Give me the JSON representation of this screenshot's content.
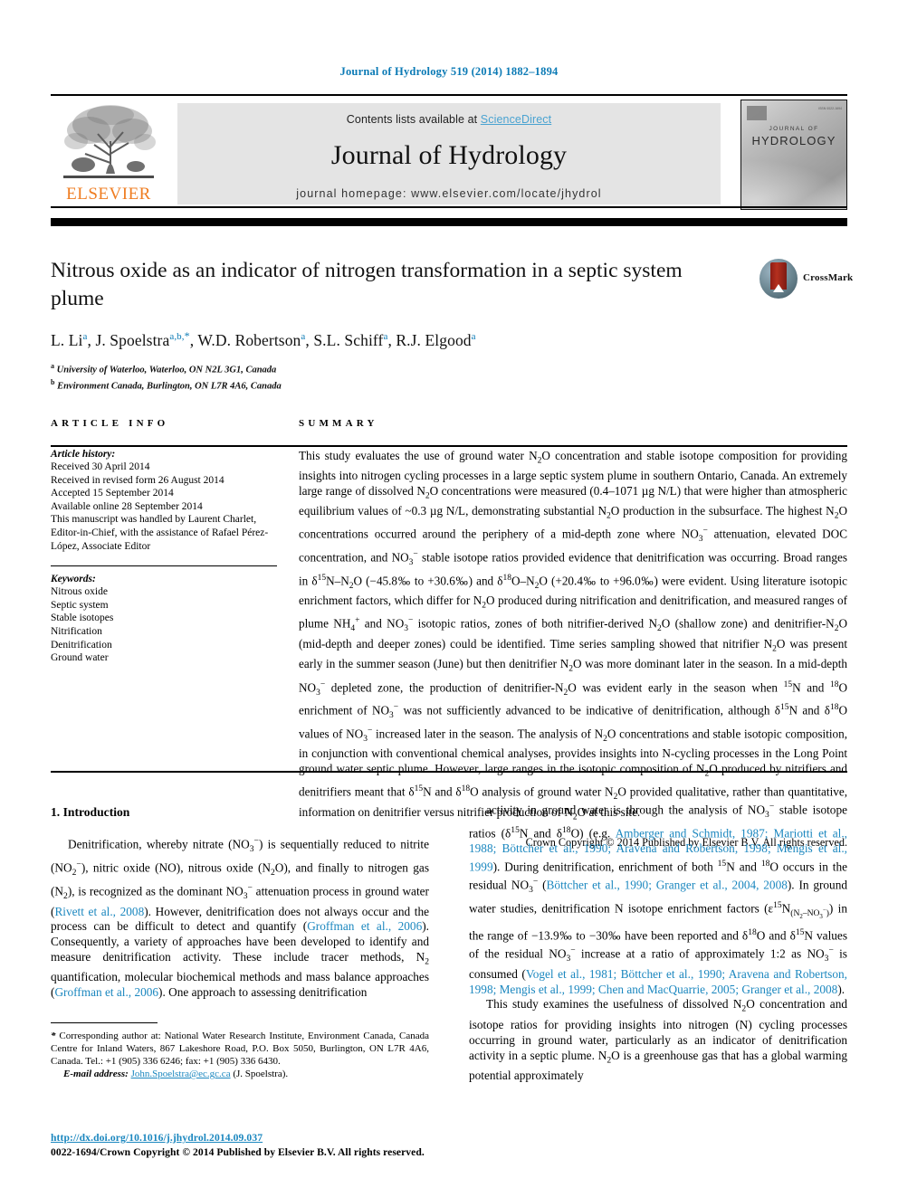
{
  "running_head": "Journal of Hydrology 519 (2014) 1882–1894",
  "masthead": {
    "contents_prefix": "Contents lists available at ",
    "sciencedirect": "ScienceDirect",
    "journal_title": "Journal of Hydrology",
    "homepage": "journal homepage: www.elsevier.com/locate/jhydrol",
    "publisher_wordmark": "ELSEVIER",
    "cover_top_line": "JOURNAL OF",
    "cover_bottom_line": "HYDROLOGY",
    "cover_isbn": "ISSN 0022-1694",
    "accent_link_color": "#4aa3d1",
    "publisher_color": "#ef7d22"
  },
  "article": {
    "title": "Nitrous oxide as an indicator of nitrogen transformation in a septic system plume",
    "crossmark_label": "CrossMark",
    "authors_plain": "L. Li a, J. Spoelstra a,b,*, W.D. Robertson a, S.L. Schiff a, R.J. Elgood a",
    "authors": [
      {
        "name": "L. Li",
        "marks": "a"
      },
      {
        "name": "J. Spoelstra",
        "marks": "a,b,*"
      },
      {
        "name": "W.D. Robertson",
        "marks": "a"
      },
      {
        "name": "S.L. Schiff",
        "marks": "a"
      },
      {
        "name": "R.J. Elgood",
        "marks": "a"
      }
    ],
    "affiliations": [
      {
        "mark": "a",
        "text": "University of Waterloo, Waterloo, ON N2L 3G1, Canada"
      },
      {
        "mark": "b",
        "text": "Environment Canada, Burlington, ON L7R 4A6, Canada"
      }
    ]
  },
  "article_info": {
    "heading": "ARTICLE INFO",
    "history_label": "Article history:",
    "history": [
      "Received 30 April 2014",
      "Received in revised form 26 August 2014",
      "Accepted 15 September 2014",
      "Available online 28 September 2014",
      "This manuscript was handled by Laurent Charlet, Editor-in-Chief, with the assistance of Rafael Pérez-López, Associate Editor"
    ],
    "keywords_label": "Keywords:",
    "keywords": [
      "Nitrous oxide",
      "Septic system",
      "Stable isotopes",
      "Nitrification",
      "Denitrification",
      "Ground water"
    ]
  },
  "summary": {
    "heading": "SUMMARY",
    "paragraph_html": "This study evaluates the use of ground water N<sub>2</sub>O concentration and stable isotope composition for providing insights into nitrogen cycling processes in a large septic system plume in southern Ontario, Canada. An extremely large range of dissolved N<sub>2</sub>O concentrations were measured (0.4–1071 µg N/L) that were higher than atmospheric equilibrium values of ~0.3 µg N/L, demonstrating substantial N<sub>2</sub>O production in the subsurface. The highest N<sub>2</sub>O concentrations occurred around the periphery of a mid-depth zone where NO<sub>3</sub><sup>−</sup> attenuation, elevated DOC concentration, and NO<sub>3</sub><sup>−</sup> stable isotope ratios provided evidence that denitrification was occurring. Broad ranges in δ<sup>15</sup>N–N<sub>2</sub>O (−45.8‰ to +30.6‰) and δ<sup>18</sup>O–N<sub>2</sub>O (+20.4‰ to +96.0‰) were evident. Using literature isotopic enrichment factors, which differ for N<sub>2</sub>O produced during nitrification and denitrification, and measured ranges of plume NH<sub>4</sub><sup>+</sup> and NO<sub>3</sub><sup>−</sup> isotopic ratios, zones of both nitrifier-derived N<sub>2</sub>O (shallow zone) and denitrifier-N<sub>2</sub>O (mid-depth and deeper zones) could be identified. Time series sampling showed that nitrifier N<sub>2</sub>O was present early in the summer season (June) but then denitrifier N<sub>2</sub>O was more dominant later in the season. In a mid-depth NO<sub>3</sub><sup>−</sup> depleted zone, the production of denitrifier-N<sub>2</sub>O was evident early in the season when <sup>15</sup>N and <sup>18</sup>O enrichment of NO<sub>3</sub><sup>−</sup> was not sufficiently advanced to be indicative of denitrification, although δ<sup>15</sup>N and δ<sup>18</sup>O values of NO<sub>3</sub><sup>−</sup> increased later in the season. The analysis of N<sub>2</sub>O concentrations and stable isotopic composition, in conjunction with conventional chemical analyses, provides insights into N-cycling processes in the Long Point ground water septic plume. However, large ranges in the isotopic composition of N<sub>2</sub>O produced by nitrifiers and denitrifiers meant that δ<sup>15</sup>N and δ<sup>18</sup>O analysis of ground water N<sub>2</sub>O provided qualitative, rather than quantitative, information on denitrifier versus nitrifier production of N<sub>2</sub>O at this site.",
    "copyright": "Crown Copyright © 2014 Published by Elsevier B.V. All rights reserved."
  },
  "body": {
    "section_heading": "1. Introduction",
    "left_paragraph_1_html": "Denitrification, whereby nitrate (NO<sub>3</sub><sup>−</sup>) is sequentially reduced to nitrite (NO<sub>2</sub><sup>−</sup>), nitric oxide (NO), nitrous oxide (N<sub>2</sub>O), and finally to nitrogen gas (N<sub>2</sub>), is recognized as the dominant NO<sub>3</sub><sup>−</sup> attenuation process in ground water (<span class=\"cite\">Rivett et al., 2008</span>). However, denitrification does not always occur and the process can be difficult to detect and quantify (<span class=\"cite\">Groffman et al., 2006</span>). Consequently, a variety of approaches have been developed to identify and measure denitrification activity. These include tracer methods, N<sub>2</sub> quantification, molecular biochemical methods and mass balance approaches (<span class=\"cite\">Groffman et al., 2006</span>). One approach to assessing denitrification",
    "right_paragraph_1_html": "activity in ground water is through the analysis of NO<sub>3</sub><sup>−</sup> stable isotope ratios (δ<sup>15</sup>N and δ<sup>18</sup>O) (e.g. <span class=\"cite\">Amberger and Schmidt, 1987; Mariotti et al., 1988; Böttcher et al., 1990; Aravena and Robertson, 1998; Mengis et al., 1999</span>). During denitrification, enrichment of both <sup>15</sup>N and <sup>18</sup>O occurs in the residual NO<sub>3</sub><sup>−</sup> (<span class=\"cite\">Böttcher et al., 1990; Granger et al., 2004, 2008</span>). In ground water studies, denitrification N isotope enrichment factors (ε<sup>15</sup>N<sub>(N<sub>2</sub>–NO<sub>3</sub><sup>−</sup>)</sub>) in the range of −13.9‰ to −30‰ have been reported and δ<sup>18</sup>O and δ<sup>15</sup>N values of the residual NO<sub>3</sub><sup>−</sup> increase at a ratio of approximately 1:2 as NO<sub>3</sub><sup>−</sup> is consumed (<span class=\"cite\">Vogel et al., 1981; Böttcher et al., 1990; Aravena and Robertson, 1998; Mengis et al., 1999; Chen and MacQuarrie, 2005; Granger et al., 2008</span>).",
    "right_paragraph_2_html": "This study examines the usefulness of dissolved N<sub>2</sub>O concentration and isotope ratios for providing insights into nitrogen (N) cycling processes occurring in ground water, particularly as an indicator of denitrification activity in a septic plume. N<sub>2</sub>O is a greenhouse gas that has a global warming potential approximately"
  },
  "footnote": {
    "corresponding_html": "<span class=\"fn-it\">*</span> Corresponding author at: National Water Research Institute, Environment Canada, Canada Centre for Inland Waters, 867 Lakeshore Road, P.O. Box 5050, Burlington, ON L7R 4A6, Canada. Tel.: +1 (905) 336 6246; fax: +1 (905) 336 6430.",
    "email_label": "E-mail address:",
    "email": "John.Spoelstra@ec.gc.ca",
    "email_suffix": "(J. Spoelstra)."
  },
  "footer": {
    "doi": "http://dx.doi.org/10.1016/j.jhydrol.2014.09.037",
    "issn_line": "0022-1694/Crown Copyright © 2014 Published by Elsevier B.V. All rights reserved."
  }
}
